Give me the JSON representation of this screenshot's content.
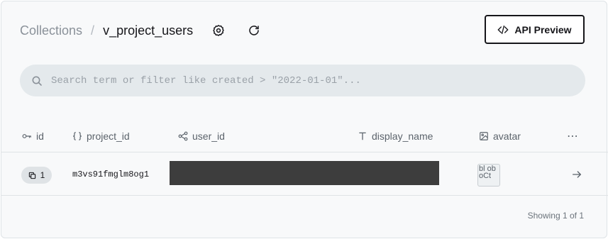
{
  "breadcrumb": {
    "root": "Collections",
    "separator": "/",
    "current": "v_project_users"
  },
  "header": {
    "api_preview_label": "API Preview"
  },
  "search": {
    "placeholder": "Search term or filter like created > \"2022-01-01\"...",
    "value": ""
  },
  "table": {
    "columns": [
      {
        "label": "id",
        "icon": "key-icon"
      },
      {
        "label": "project_id",
        "icon": "json-braces-icon"
      },
      {
        "label": "user_id",
        "icon": "relation-icon"
      },
      {
        "label": "display_name",
        "icon": "text-icon"
      },
      {
        "label": "avatar",
        "icon": "image-icon"
      }
    ],
    "more_label": "⋯",
    "rows": [
      {
        "id": "1",
        "project_id": "m3vs91fmglm8og1",
        "user_id": "",
        "display_name": "",
        "avatar_alt": "bl ob oCt"
      }
    ]
  },
  "footer": {
    "showing": "Showing 1 of 1"
  }
}
